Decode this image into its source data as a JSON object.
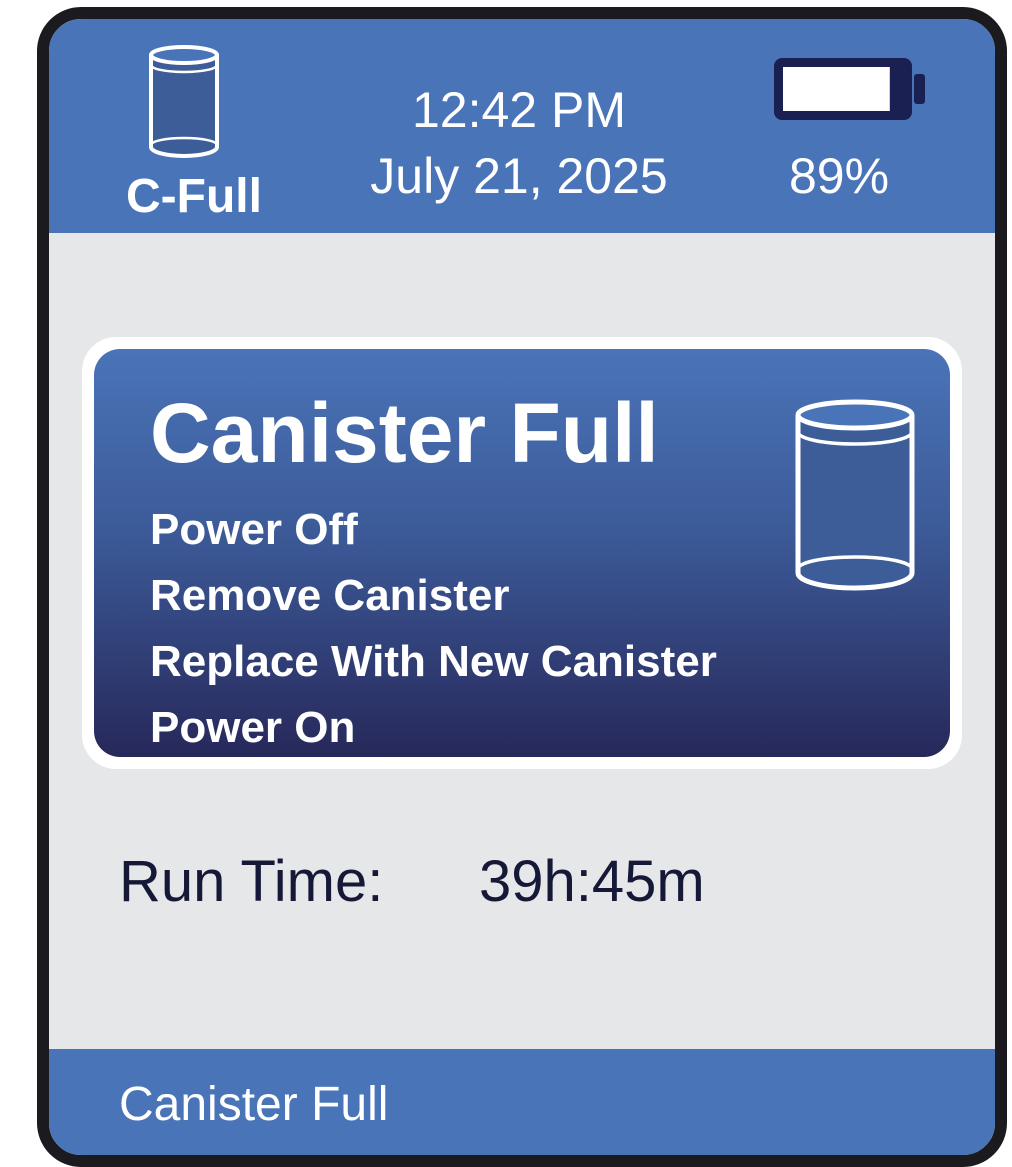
{
  "header": {
    "status_icon": "canister-full-icon",
    "status_label": "C-Full",
    "time": "12:42 PM",
    "date": "July 21, 2025",
    "battery_icon": "battery-icon",
    "battery_percent": "89%",
    "battery_level": 0.89
  },
  "alert": {
    "title": "Canister Full",
    "icon": "canister-full-icon",
    "steps": [
      "Power Off",
      "Remove Canister",
      "Replace With New Canister",
      "Power On"
    ]
  },
  "runtime": {
    "label": "Run Time:",
    "value": "39h:45m"
  },
  "footer": {
    "status_text": "Canister Full"
  },
  "colors": {
    "header_blue": "#4a74b8",
    "card_gradient_top": "#4a74b8",
    "card_gradient_bottom": "#27285a",
    "screen_background": "#e6e7e9",
    "bezel": "#1b1b1f",
    "runtime_text": "#161838"
  }
}
